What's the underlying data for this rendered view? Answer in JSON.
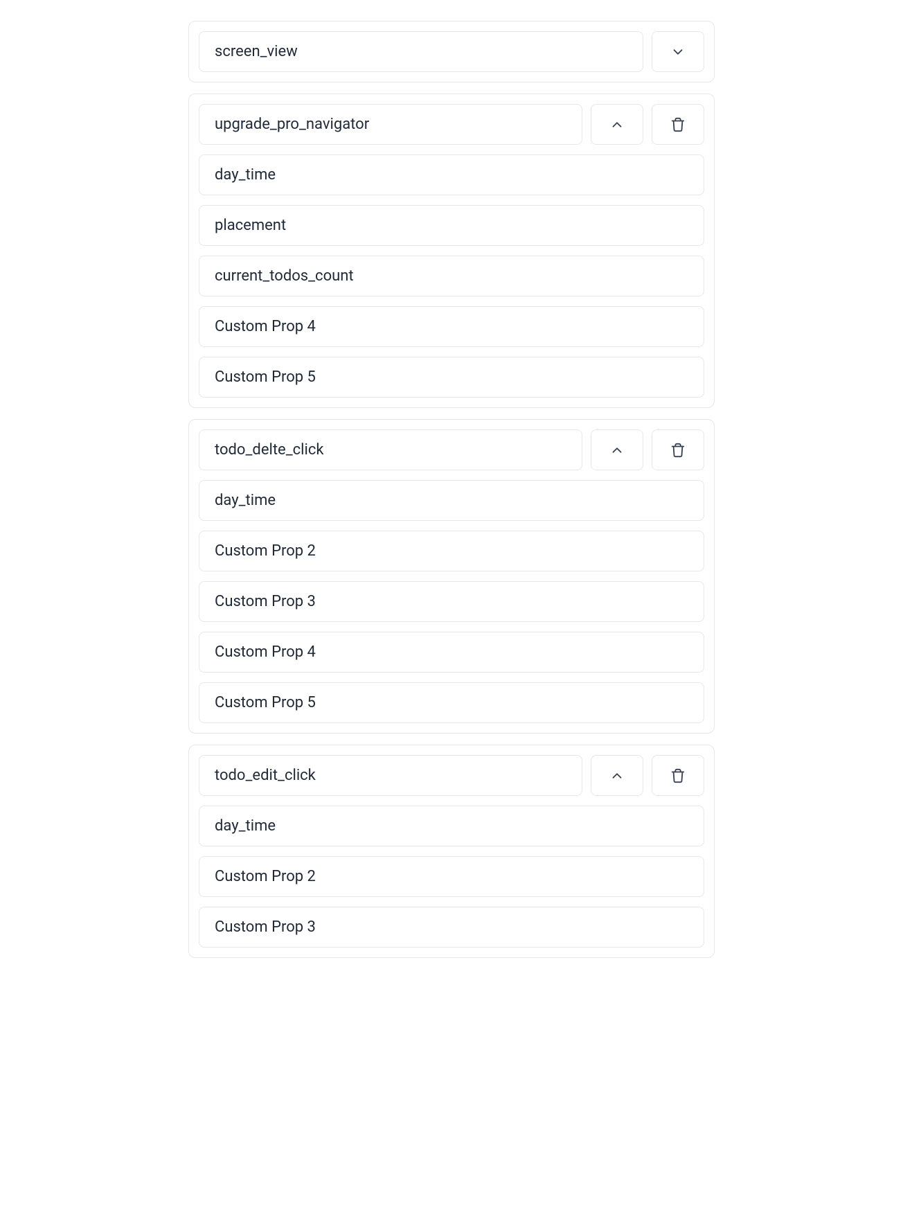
{
  "events": [
    {
      "name": "screen_view",
      "expanded": false,
      "deletable": false,
      "props": []
    },
    {
      "name": "upgrade_pro_navigator",
      "expanded": true,
      "deletable": true,
      "props": [
        "day_time",
        "placement",
        "current_todos_count",
        "Custom Prop 4",
        "Custom Prop 5"
      ]
    },
    {
      "name": "todo_delte_click",
      "expanded": true,
      "deletable": true,
      "props": [
        "day_time",
        "Custom Prop 2",
        "Custom Prop 3",
        "Custom Prop 4",
        "Custom Prop 5"
      ]
    },
    {
      "name": "todo_edit_click",
      "expanded": true,
      "deletable": true,
      "props": [
        "day_time",
        "Custom Prop 2",
        "Custom Prop 3"
      ]
    }
  ]
}
